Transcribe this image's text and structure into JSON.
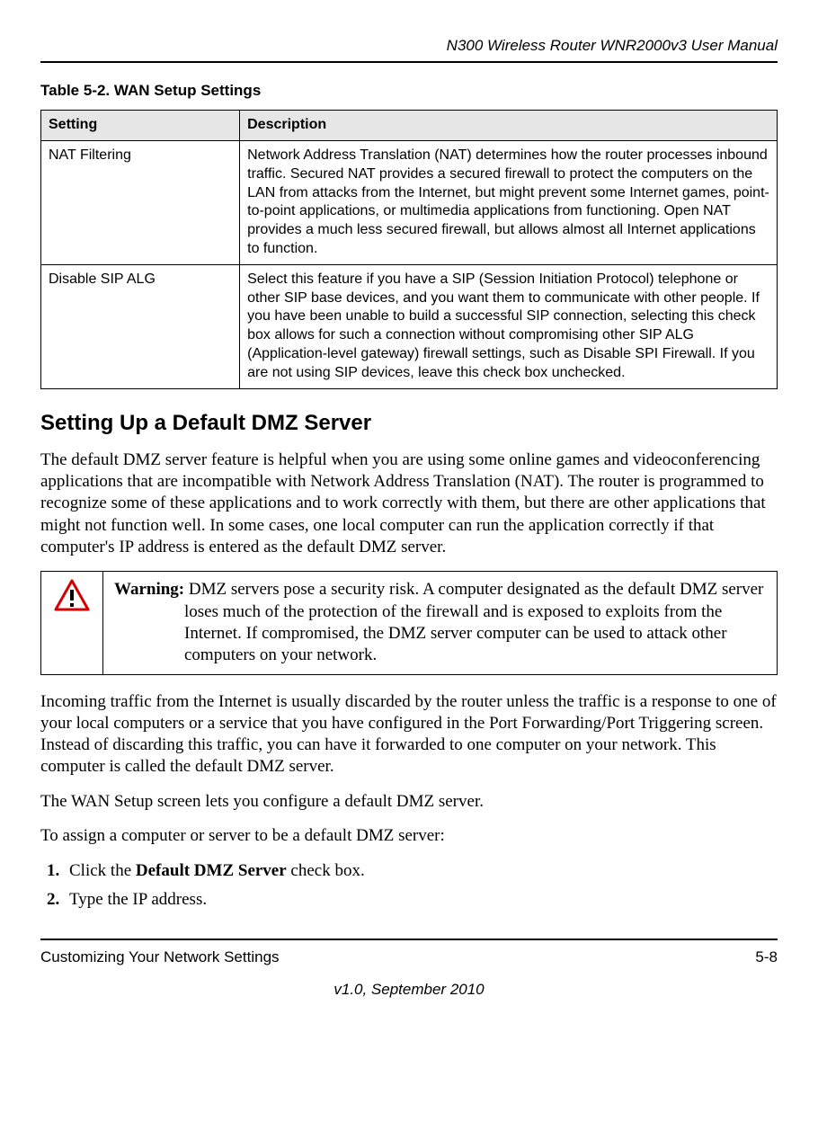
{
  "header": {
    "title": "N300 Wireless Router WNR2000v3 User Manual"
  },
  "table": {
    "caption": "Table 5-2.  WAN Setup Settings",
    "headers": {
      "setting": "Setting",
      "description": "Description"
    },
    "rows": [
      {
        "setting": "NAT Filtering",
        "description": "Network Address Translation (NAT) determines how the router processes inbound traffic. Secured NAT provides a secured firewall to protect the computers on the LAN from attacks from the Internet, but might prevent some Internet games, point-to-point applications, or multimedia applications from functioning. Open NAT provides a much less secured firewall, but allows almost all Internet applications to function."
      },
      {
        "setting": "Disable SIP ALG",
        "description": "Select this feature if you have a SIP (Session Initiation Protocol) telephone or other SIP base devices, and you want them to communicate with other people. If you have been unable to build a successful SIP connection, selecting this check box allows for such a connection without compromising other SIP ALG (Application-level gateway) firewall settings, such as Disable SPI Firewall. If you are not using SIP devices, leave this check box unchecked."
      }
    ]
  },
  "section": {
    "heading": "Setting Up a Default DMZ Server",
    "para1": "The default DMZ server feature is helpful when you are using some online games and videoconferencing applications that are incompatible with Network Address Translation (NAT). The router is programmed to recognize some of these applications and to work correctly with them, but there are other applications that might not function well. In some cases, one local computer can run the application correctly if that computer's IP address is entered as the default DMZ server.",
    "warning_label": "Warning:",
    "warning_body": " DMZ servers pose a security risk. A computer designated as the default DMZ server loses much of the protection of the firewall and is exposed to exploits from the Internet. If compromised, the DMZ server computer can be used to attack other computers on your network.",
    "para2": "Incoming traffic from the Internet is usually discarded by the router unless the traffic is a response to one of your local computers or a service that you have configured in the Port Forwarding/Port Triggering screen. Instead of discarding this traffic, you can have it forwarded to one computer on your network. This computer is called the default DMZ server.",
    "para3": "The WAN Setup screen lets you configure a default DMZ server.",
    "para4": "To assign a computer or server to be a default DMZ server:",
    "step1_pre": "Click the ",
    "step1_bold": "Default DMZ Server",
    "step1_post": " check box.",
    "step2": "Type the IP address."
  },
  "footer": {
    "left": "Customizing Your Network Settings",
    "right": "5-8",
    "version": "v1.0, September 2010"
  }
}
